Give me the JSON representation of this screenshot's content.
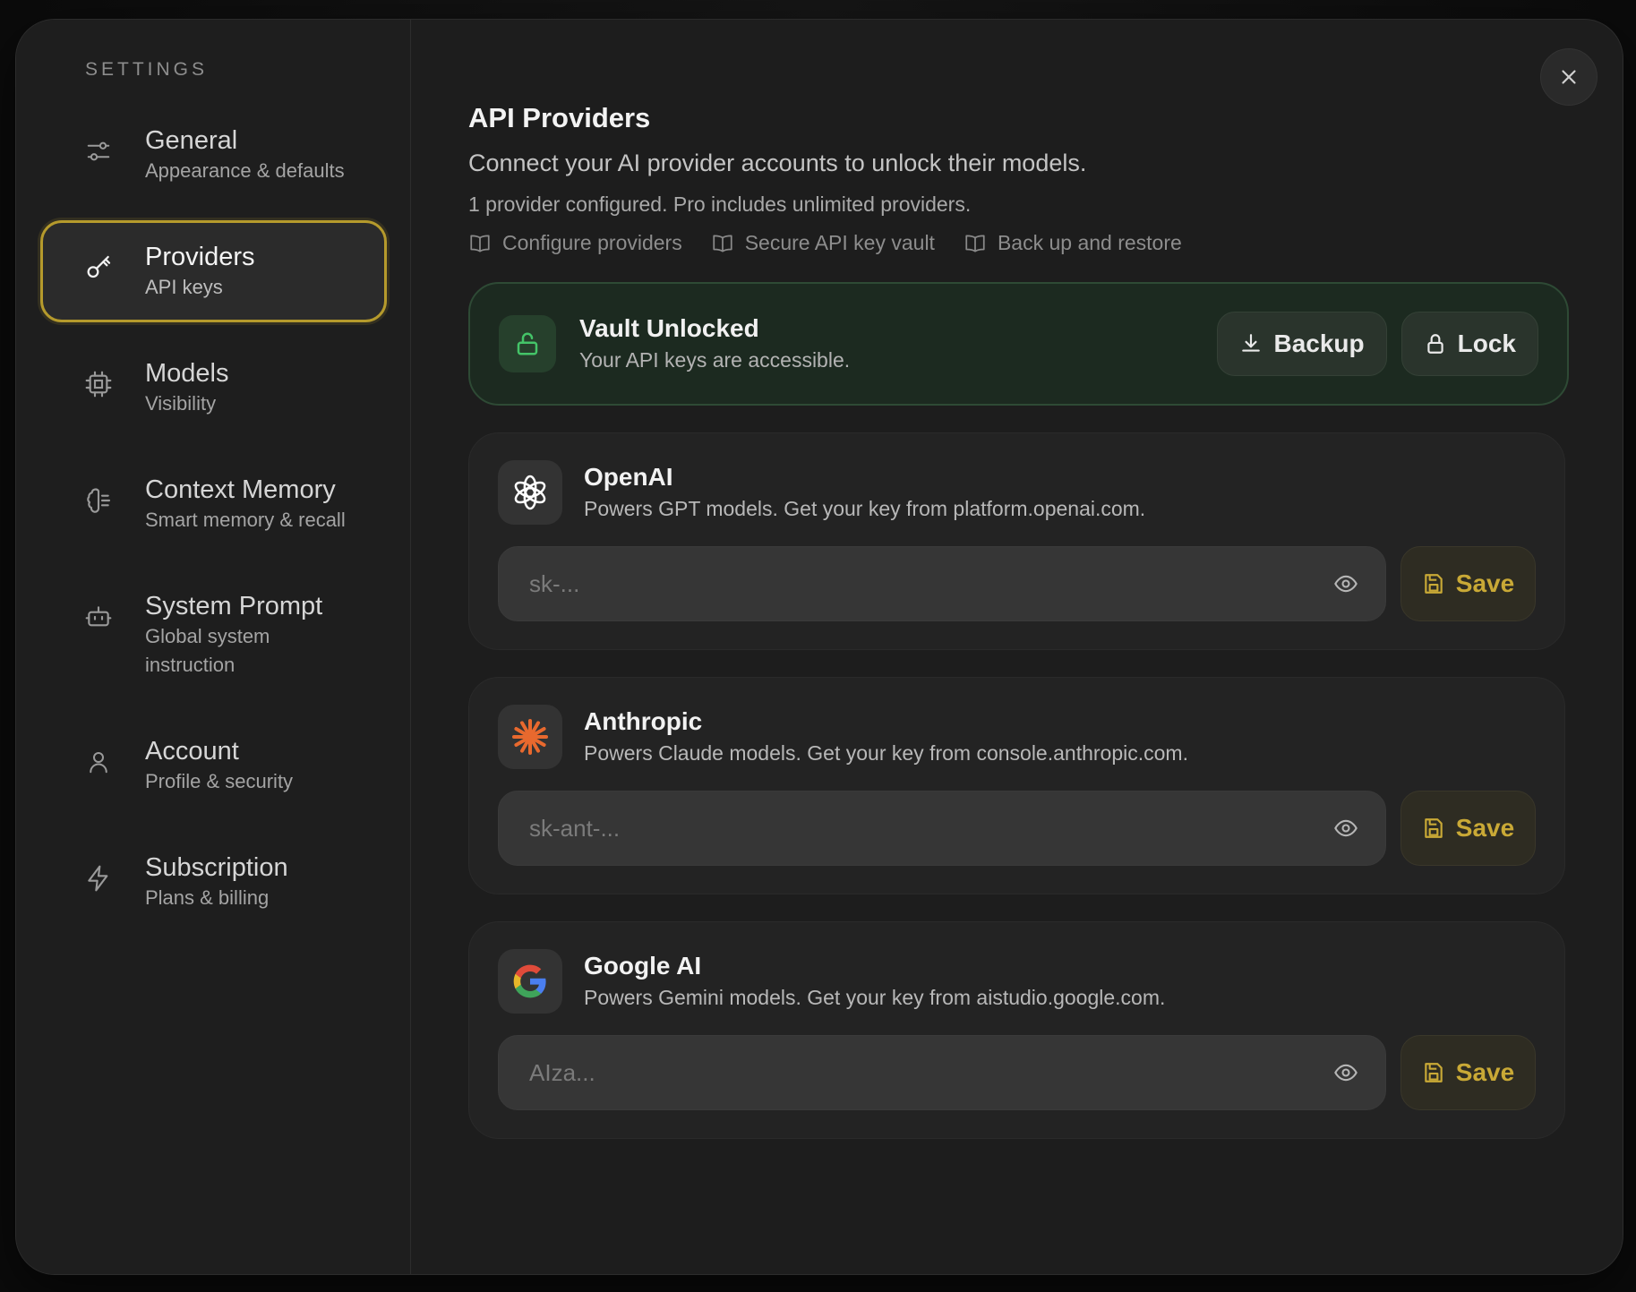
{
  "sidebar": {
    "heading": "SETTINGS",
    "items": [
      {
        "title": "General",
        "subtitle": "Appearance & defaults",
        "icon": "sliders-icon",
        "active": false
      },
      {
        "title": "Providers",
        "subtitle": "API keys",
        "icon": "key-icon",
        "active": true
      },
      {
        "title": "Models",
        "subtitle": "Visibility",
        "icon": "cpu-chip-icon",
        "active": false
      },
      {
        "title": "Context Memory",
        "subtitle": "Smart memory & recall",
        "icon": "brain-icon",
        "active": false
      },
      {
        "title": "System Prompt",
        "subtitle": "Global system instruction",
        "icon": "bot-icon",
        "active": false
      },
      {
        "title": "Account",
        "subtitle": "Profile & security",
        "icon": "user-icon",
        "active": false
      },
      {
        "title": "Subscription",
        "subtitle": "Plans & billing",
        "icon": "lightning-icon",
        "active": false
      }
    ]
  },
  "main": {
    "title": "API Providers",
    "description": "Connect your AI provider accounts to unlock their models.",
    "note": "1 provider configured. Pro includes unlimited providers.",
    "doc_links": [
      "Configure providers",
      "Secure API key vault",
      "Back up and restore"
    ]
  },
  "vault": {
    "title": "Vault Unlocked",
    "subtitle": "Your API keys are accessible.",
    "backup_label": "Backup",
    "lock_label": "Lock",
    "accent": "#44c468"
  },
  "providers": [
    {
      "name": "OpenAI",
      "description": "Powers GPT models. Get your key from platform.openai.com.",
      "placeholder": "sk-...",
      "value": "",
      "save_label": "Save",
      "icon": "openai-logo-icon"
    },
    {
      "name": "Anthropic",
      "description": "Powers Claude models. Get your key from console.anthropic.com.",
      "placeholder": "sk-ant-...",
      "value": "",
      "save_label": "Save",
      "icon": "anthropic-logo-icon"
    },
    {
      "name": "Google AI",
      "description": "Powers Gemini models. Get your key from aistudio.google.com.",
      "placeholder": "AIza...",
      "value": "",
      "save_label": "Save",
      "icon": "google-logo-icon"
    }
  ],
  "colors": {
    "active_border": "#b59a2c",
    "save_text": "#c9a936",
    "anthropic_orange": "#e8692e"
  }
}
